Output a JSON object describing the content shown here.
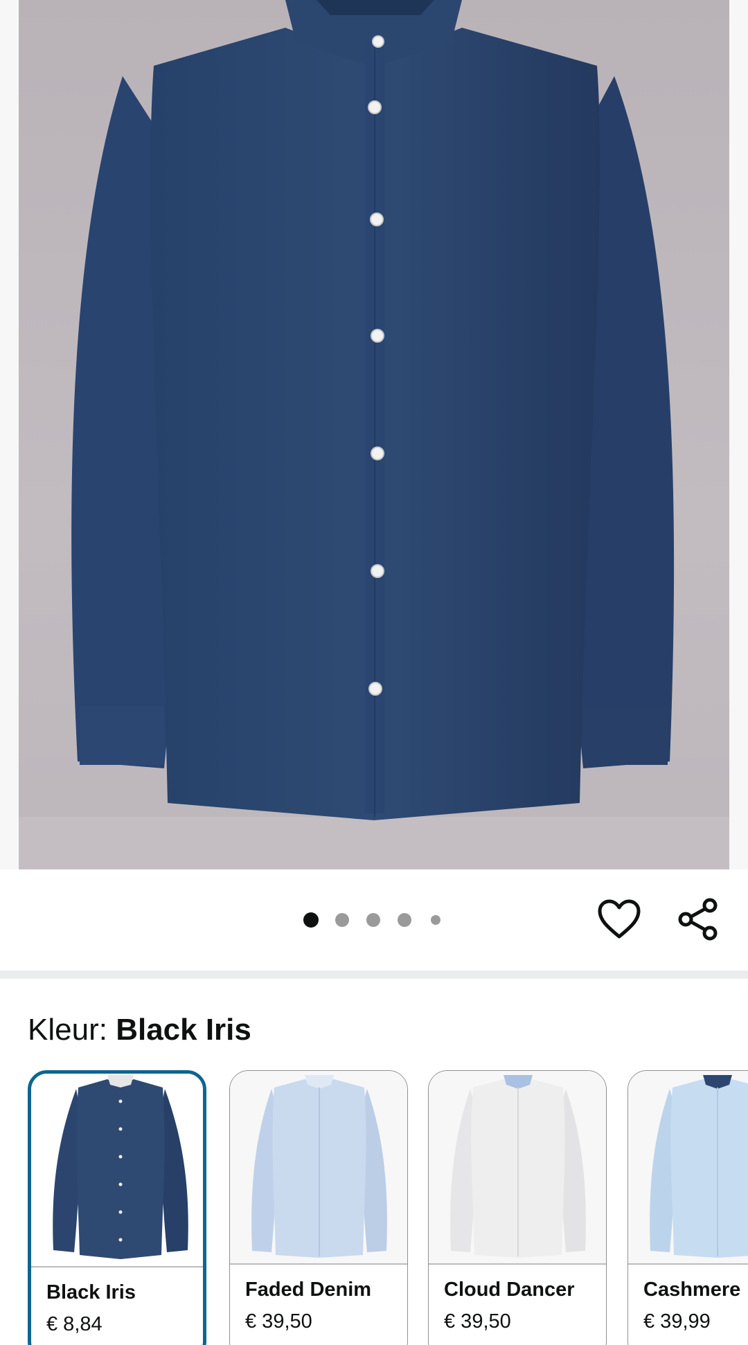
{
  "product": {
    "image_alt": "Navy long-sleeve shirt",
    "gallery": {
      "count": 5,
      "active_index": 0
    }
  },
  "actions": {
    "favorite_icon": "heart-icon",
    "share_icon": "share-icon"
  },
  "color_selector": {
    "label": "Kleur:",
    "selected_value": "Black Iris",
    "options": [
      {
        "name": "Black Iris",
        "price": "€ 8,84",
        "shirt_color": "#2f4a72"
      },
      {
        "name": "Faded Denim",
        "price": "€ 39,50",
        "shirt_color": "#c9d9ee"
      },
      {
        "name": "Cloud Dancer",
        "price": "€ 39,50",
        "shirt_color": "#eeeeef"
      },
      {
        "name": "Cashmere",
        "price": "€ 39,99",
        "shirt_color": "#c6dcf1"
      }
    ]
  },
  "colors": {
    "selected_border": "#0d6690",
    "shirt_navy": "#2e4a72",
    "background_grey": "#bdb7bc"
  }
}
